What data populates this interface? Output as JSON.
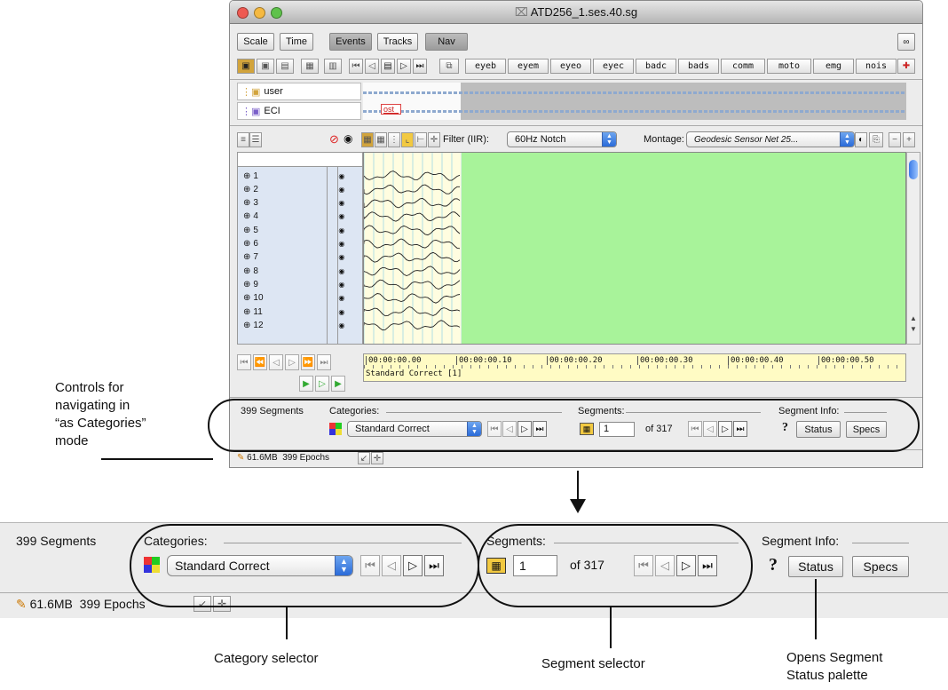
{
  "window": {
    "title": "ATD256_1.ses.40.sg",
    "tabs": [
      {
        "label": "Scale"
      },
      {
        "label": "Time"
      },
      {
        "label": "Events"
      },
      {
        "label": "Tracks"
      },
      {
        "label": "Nav"
      }
    ],
    "event_codes": [
      "eyeb",
      "eyem",
      "eyeo",
      "eyec",
      "badc",
      "bads",
      "comm",
      "moto",
      "emg",
      "nois"
    ],
    "tracks": [
      {
        "label": "user"
      },
      {
        "label": "ECI"
      }
    ],
    "event_marker": "ost_",
    "filter": {
      "label": "Filter (IIR):",
      "value": "60Hz Notch"
    },
    "montage": {
      "label": "Montage:",
      "value": "Geodesic Sensor Net 25..."
    },
    "channels": [
      "1",
      "2",
      "3",
      "4",
      "5",
      "6",
      "7",
      "8",
      "9",
      "10",
      "11",
      "12"
    ],
    "timeline": {
      "ticks": [
        "00:00:00.00",
        "00:00:00.10",
        "00:00:00.20",
        "00:00:00.30",
        "00:00:00.40",
        "00:00:00.50"
      ],
      "segment_label": "Standard Correct [1]"
    },
    "nav": {
      "segments_count": "399 Segments",
      "categories_label": "Categories:",
      "category_value": "Standard Correct",
      "segments_label": "Segments:",
      "segment_value": "1",
      "segment_of": "of 317",
      "segment_info_label": "Segment Info:",
      "help": "?",
      "status_button": "Status",
      "specs_button": "Specs"
    },
    "statusbar": {
      "memory": "61.6MB",
      "epochs": "399 Epochs"
    }
  },
  "zoom": {
    "segments_count": "399 Segments",
    "categories_label": "Categories:",
    "category_value": "Standard Correct",
    "segments_label": "Segments:",
    "segment_value": "1",
    "segment_of": "of 317",
    "segment_info_label": "Segment Info:",
    "help": "?",
    "status_button": "Status",
    "specs_button": "Specs",
    "memory": "61.6MB",
    "epochs": "399 Epochs"
  },
  "annotations": {
    "controls_lines": [
      "Controls for",
      "navigating in",
      "“as Categories”",
      "mode"
    ],
    "category_selector": "Category selector",
    "segment_selector": "Segment selector",
    "opens_status_lines": [
      "Opens Segment",
      "Status palette"
    ]
  },
  "colors": {
    "plot_bg": "#a8f39a",
    "wave_bg": "#fffde0",
    "timeline_bg": "#fffbc4",
    "channel_bg": "#dde6f3"
  }
}
